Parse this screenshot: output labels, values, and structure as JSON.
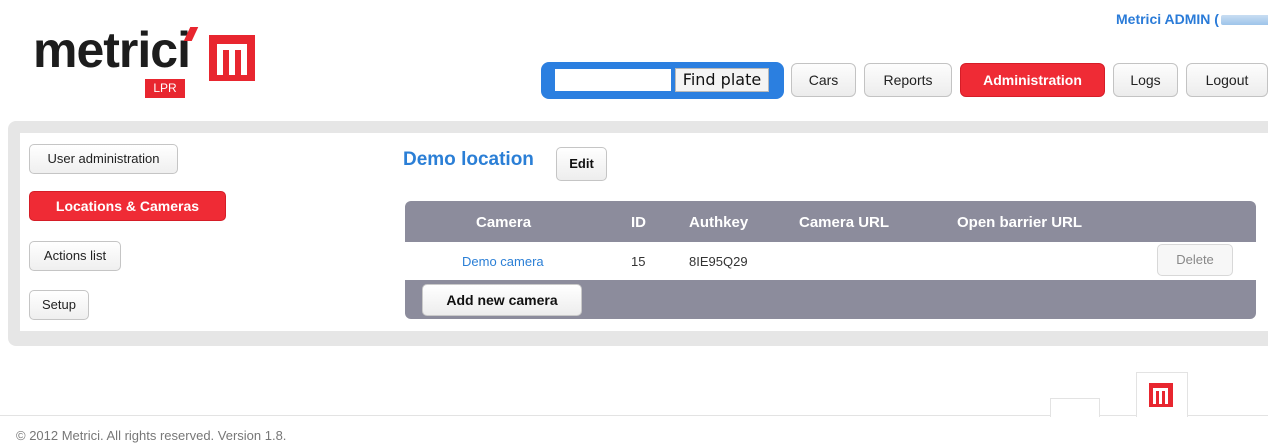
{
  "brand": {
    "logo_word": "metrici",
    "logo_badge": "LPR"
  },
  "header": {
    "user_label": "Metrici ADMIN (",
    "find_placeholder": "",
    "find_button": "Find plate",
    "nav": [
      {
        "label": "Cars"
      },
      {
        "label": "Reports"
      },
      {
        "label": "Administration",
        "active": true
      },
      {
        "label": "Logs"
      },
      {
        "label": "Logout"
      }
    ]
  },
  "sidebar": {
    "items": [
      {
        "label": "User administration"
      },
      {
        "label": "Locations & Cameras",
        "active": true
      },
      {
        "label": "Actions list"
      },
      {
        "label": "Setup"
      }
    ]
  },
  "location": {
    "title": "Demo location",
    "edit_label": "Edit"
  },
  "table": {
    "headers": [
      "Camera",
      "ID",
      "Authkey",
      "Camera URL",
      "Open barrier URL"
    ],
    "rows": [
      {
        "camera": "Demo camera",
        "id": "15",
        "authkey": "8IE95Q29",
        "camera_url": "",
        "barrier_url": "",
        "delete_label": "Delete"
      }
    ],
    "add_label": "Add new camera"
  },
  "footer": {
    "copyright": "© 2012 Metrici. All rights reserved. Version 1.8."
  },
  "colors": {
    "accent_red": "#ef2b35",
    "accent_blue": "#2b7fd6",
    "table_header": "#8c8c9c"
  }
}
